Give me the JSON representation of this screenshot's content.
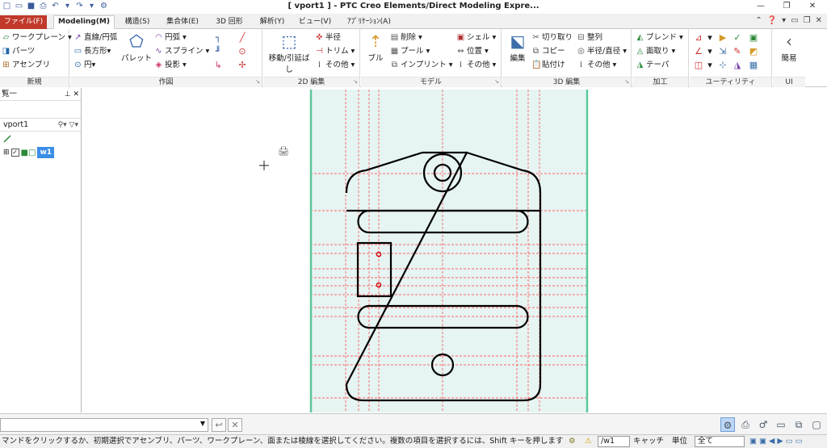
{
  "app": {
    "title": "[ vport1 ] - PTC Creo Elements/Direct Modeling Expre...",
    "quick_access_icons": [
      "new-file-icon",
      "open-file-icon",
      "save-icon",
      "print-icon",
      "undo-icon",
      "undo-dropdown-icon",
      "redo-icon",
      "redo-dropdown-icon",
      "customize-icon"
    ],
    "window_controls": [
      "minimize-icon",
      "restore-icon",
      "close-icon"
    ]
  },
  "tabs": [
    {
      "label": "ファイル(F)",
      "active": false
    },
    {
      "label": "Modeling(M)",
      "active": true
    },
    {
      "label": "構造(S)",
      "active": false
    },
    {
      "label": "集合体(E)",
      "active": false
    },
    {
      "label": "3D 回形",
      "active": false
    },
    {
      "label": "解析(Y)",
      "active": false
    },
    {
      "label": "ビュー(V)",
      "active": false
    },
    {
      "label": "ｱﾌﾟﾘｹｰｼｮﾝ(A)",
      "active": false
    }
  ],
  "ribbon": {
    "groups": {
      "new": {
        "label": "新規",
        "items": [
          "ワークプレーン",
          "パーツ",
          "アセンブリ"
        ]
      },
      "draw": {
        "label": "作図",
        "items": [
          "直線/円弧",
          "長方形",
          "円",
          "パレット",
          "円弧",
          "スプライン",
          "投影"
        ]
      },
      "edit2d": {
        "label": "2D 編集",
        "items": [
          "移動/引延ばし",
          "半径",
          "トリム",
          "その他"
        ]
      },
      "model": {
        "label": "モデル",
        "items": [
          "ブル",
          "削除",
          "プール",
          "インプリント",
          "シェル",
          "位置",
          "その他"
        ]
      },
      "edit3d": {
        "label": "3D 編集",
        "items": [
          "編集",
          "切り取り",
          "コピー",
          "貼付け",
          "整列",
          "半径/直径",
          "その他"
        ]
      },
      "machining": {
        "label": "加工",
        "items": [
          "ブレンド",
          "面取り",
          "テーパ"
        ]
      },
      "utility": {
        "label": "ユーティリティ",
        "items": []
      },
      "ui": {
        "label": "UI",
        "items": [
          "簡易"
        ]
      }
    }
  },
  "sidebar": {
    "title": "覧一",
    "viewport_name": "vport1",
    "tree": [
      {
        "label": "w1",
        "checked": true,
        "selected": true
      }
    ]
  },
  "status": {
    "message": "マンドをクリックするか、初期選択でアセンブリ、パーツ、ワークプレーン、面または稜線を選択してください。複数の項目を選択するには、Shift キーを押します",
    "workplane": "/w1",
    "catch_label": "キャッチ",
    "unit_label": "単位",
    "filter_value": "全て"
  },
  "colors": {
    "canvas_band": "#e6f4f2",
    "band_edge": "#5cc79c",
    "construction_lines": "#ff1a1a",
    "part_outline": "#000000",
    "active_tab_text": "#1a1a1a",
    "file_tab": "#c0392b",
    "selected_tree": "#3a8ee6"
  }
}
